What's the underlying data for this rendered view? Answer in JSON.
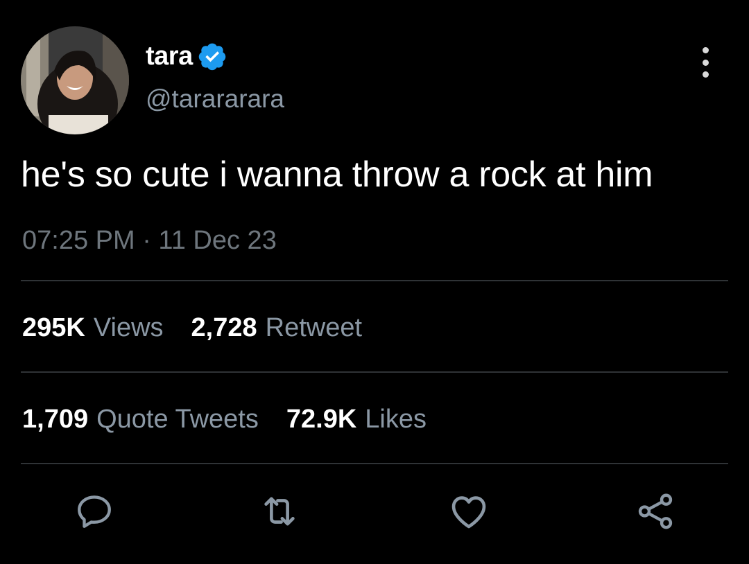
{
  "author": {
    "display_name": "tara",
    "handle": "@tarararara",
    "verified": true,
    "avatar_icon": "profile-photo"
  },
  "tweet": {
    "text": "he's so cute i wanna throw a rock at him",
    "timestamp": "07:25 PM · 11 Dec 23"
  },
  "stats": {
    "views_count": "295K",
    "views_label": "Views",
    "retweets_count": "2,728",
    "retweets_label": "Retweet",
    "quotes_count": "1,709",
    "quotes_label": "Quote Tweets",
    "likes_count": "72.9K",
    "likes_label": "Likes"
  },
  "actions": {
    "reply_icon": "reply-icon",
    "retweet_icon": "retweet-icon",
    "like_icon": "heart-icon",
    "share_icon": "share-icon"
  },
  "colors": {
    "background": "#000000",
    "primary_text": "#ffffff",
    "secondary_text": "#8b98a5",
    "verified_blue": "#1d9bf0",
    "divider": "#2f3336"
  }
}
